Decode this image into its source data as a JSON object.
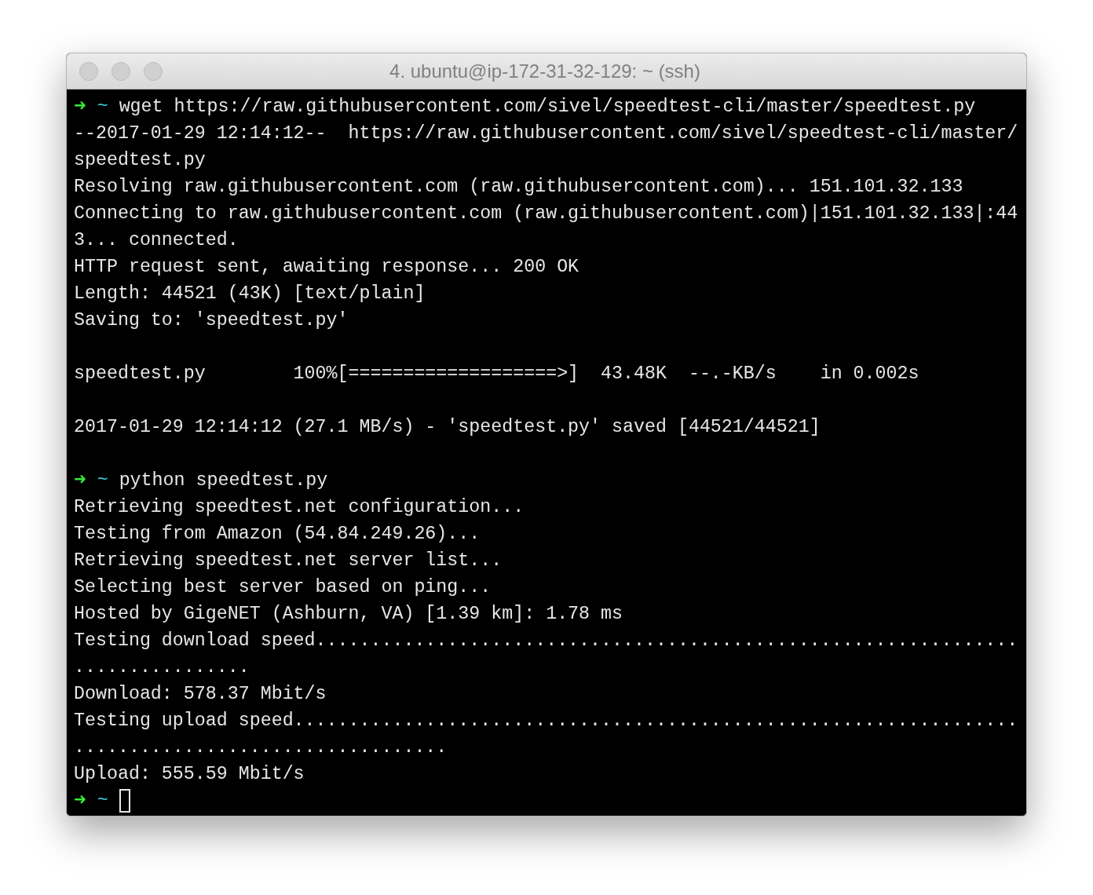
{
  "window": {
    "title": "4. ubuntu@ip-172-31-32-129: ~ (ssh)"
  },
  "terminal": {
    "lines": [
      {
        "kind": "prompt",
        "symbol": "➜",
        "cwd": "~",
        "command": "wget https://raw.githubusercontent.com/sivel/speedtest-cli/master/speedtest.py",
        "cursor": false
      },
      {
        "kind": "output",
        "text": "--2017-01-29 12:14:12--  https://raw.githubusercontent.com/sivel/speedtest-cli/master/"
      },
      {
        "kind": "output",
        "text": "speedtest.py"
      },
      {
        "kind": "output",
        "text": "Resolving raw.githubusercontent.com (raw.githubusercontent.com)... 151.101.32.133"
      },
      {
        "kind": "output",
        "text": "Connecting to raw.githubusercontent.com (raw.githubusercontent.com)|151.101.32.133|:44"
      },
      {
        "kind": "output",
        "text": "3... connected."
      },
      {
        "kind": "output",
        "text": "HTTP request sent, awaiting response... 200 OK"
      },
      {
        "kind": "output",
        "text": "Length: 44521 (43K) [text/plain]"
      },
      {
        "kind": "output",
        "text": "Saving to: 'speedtest.py'"
      },
      {
        "kind": "blank"
      },
      {
        "kind": "output",
        "text": "speedtest.py        100%[===================>]  43.48K  --.-KB/s    in 0.002s"
      },
      {
        "kind": "blank"
      },
      {
        "kind": "output",
        "text": "2017-01-29 12:14:12 (27.1 MB/s) - 'speedtest.py' saved [44521/44521]"
      },
      {
        "kind": "blank"
      },
      {
        "kind": "prompt",
        "symbol": "➜",
        "cwd": "~",
        "command": "python speedtest.py",
        "cursor": false
      },
      {
        "kind": "output",
        "text": "Retrieving speedtest.net configuration..."
      },
      {
        "kind": "output",
        "text": "Testing from Amazon (54.84.249.26)..."
      },
      {
        "kind": "output",
        "text": "Retrieving speedtest.net server list..."
      },
      {
        "kind": "output",
        "text": "Selecting best server based on ping..."
      },
      {
        "kind": "output",
        "text": "Hosted by GigeNET (Ashburn, VA) [1.39 km]: 1.78 ms"
      },
      {
        "kind": "output",
        "text": "Testing download speed................................................................"
      },
      {
        "kind": "output",
        "text": "................"
      },
      {
        "kind": "output",
        "text": "Download: 578.37 Mbit/s"
      },
      {
        "kind": "output",
        "text": "Testing upload speed.................................................................."
      },
      {
        "kind": "output",
        "text": ".................................."
      },
      {
        "kind": "output",
        "text": "Upload: 555.59 Mbit/s"
      },
      {
        "kind": "prompt",
        "symbol": "➜",
        "cwd": "~",
        "cursor": true
      }
    ]
  }
}
